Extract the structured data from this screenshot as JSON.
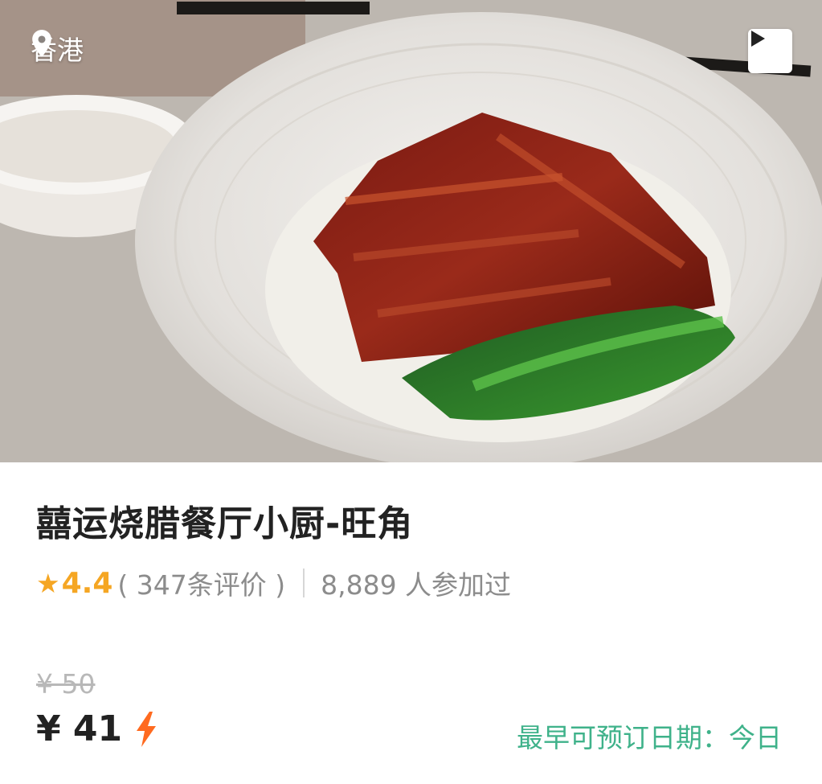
{
  "header": {
    "location": "香港",
    "location_icon": "location-pin-icon",
    "play_icon": "play-icon"
  },
  "restaurant": {
    "name": "囍运烧腊餐厅小厨-旺角",
    "rating": "4.4",
    "reviews": "( 347条评价 )",
    "joined": "8,889 人参加过"
  },
  "pricing": {
    "original_price": "¥ 50",
    "current_price": "¥ 41",
    "badge_icon": "lightning-icon",
    "earliest_booking": "最早可预订日期：今日"
  },
  "colors": {
    "rating": "#f5a623",
    "booking": "#3fb28a",
    "bolt": "#ff6a1f"
  }
}
